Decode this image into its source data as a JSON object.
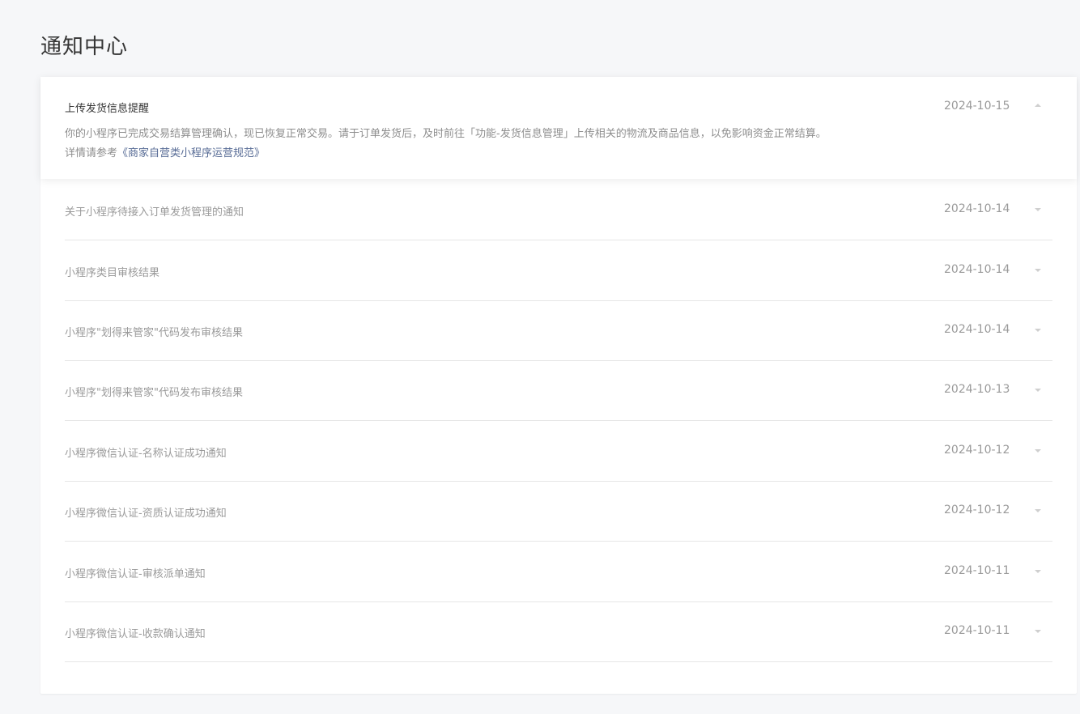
{
  "page": {
    "title": "通知中心"
  },
  "expanded": {
    "title": "上传发货信息提醒",
    "date": "2024-10-15",
    "body": "你的小程序已完成交易结算管理确认，现已恢复正常交易。请于订单发货后，及时前往「功能-发货信息管理」上传相关的物流及商品信息，以免影响资金正常结算。",
    "detail_prefix": "详情请参考",
    "detail_link": "《商家自营类小程序运营规范》",
    "caret": "caret-up-icon"
  },
  "notifications": [
    {
      "title": "关于小程序待接入订单发货管理的通知",
      "date": "2024-10-14"
    },
    {
      "title": "小程序类目审核结果",
      "date": "2024-10-14"
    },
    {
      "title": "小程序\"划得来管家\"代码发布审核结果",
      "date": "2024-10-14"
    },
    {
      "title": "小程序\"划得来管家\"代码发布审核结果",
      "date": "2024-10-13"
    },
    {
      "title": "小程序微信认证-名称认证成功通知",
      "date": "2024-10-12"
    },
    {
      "title": "小程序微信认证-资质认证成功通知",
      "date": "2024-10-12"
    },
    {
      "title": "小程序微信认证-审核派单通知",
      "date": "2024-10-11"
    },
    {
      "title": "小程序微信认证-收款确认通知",
      "date": "2024-10-11"
    }
  ],
  "colors": {
    "link": "#576b95",
    "title": "#353535",
    "muted": "#9a9a9a",
    "background": "#f6f7f9"
  }
}
